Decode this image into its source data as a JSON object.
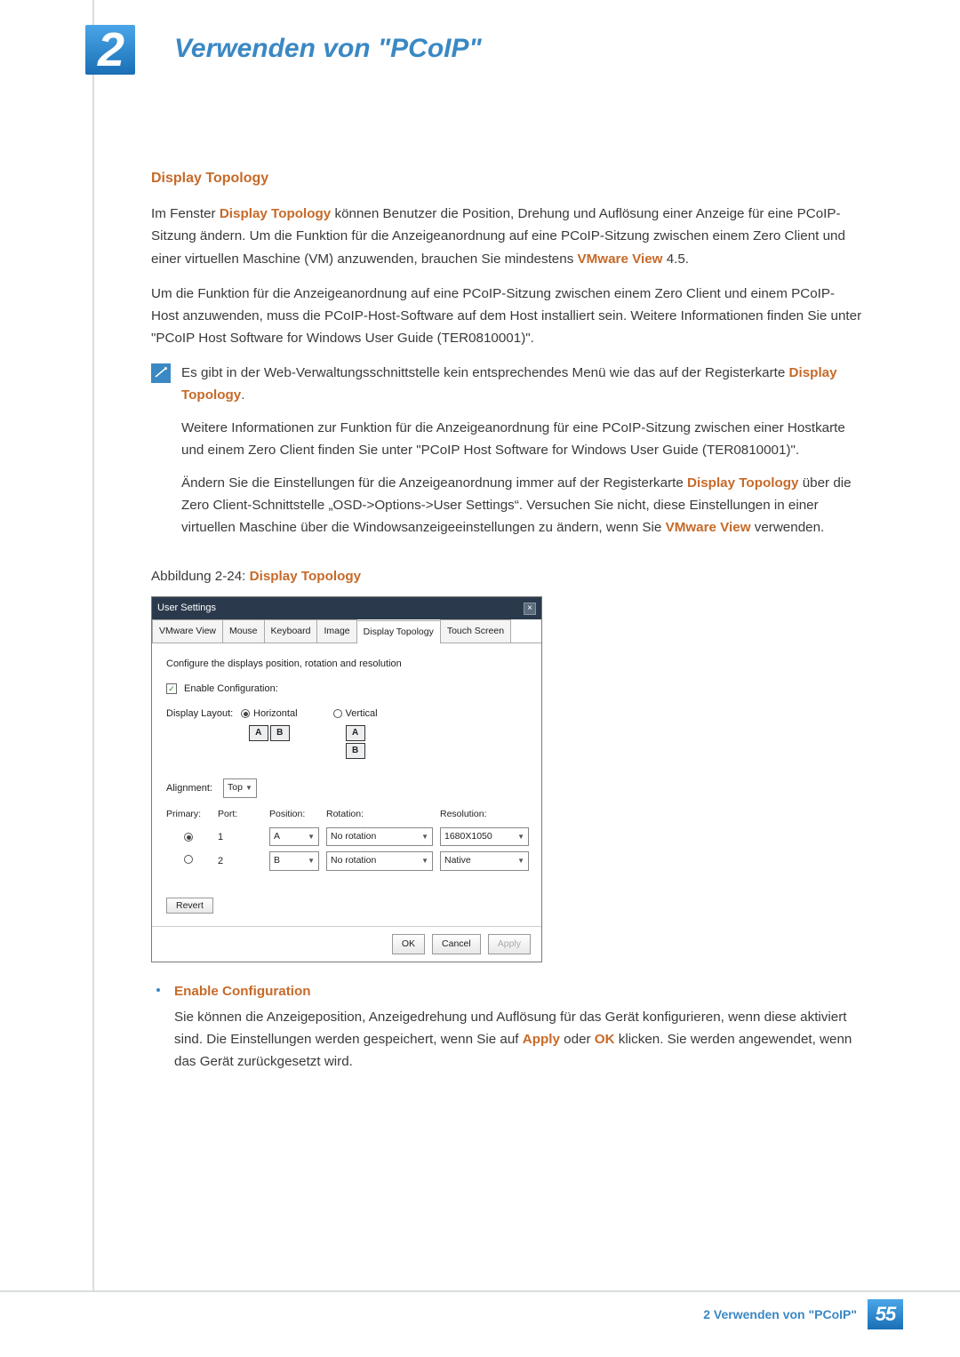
{
  "chapter": {
    "number": "2",
    "title": "Verwenden von \"PCoIP\""
  },
  "section": {
    "heading": "Display Topology"
  },
  "p1": {
    "a": "Im Fenster ",
    "b": "Display Topology",
    "c": " können Benutzer die Position, Drehung und Auflösung einer Anzeige für eine PCoIP-Sitzung ändern. Um die Funktion für die Anzeigeanordnung auf eine PCoIP-Sitzung zwischen einem Zero Client und einer virtuellen Maschine (VM) anzuwenden, brauchen Sie mindestens ",
    "d": "VMware View",
    "e": " 4.5."
  },
  "p2": "Um die Funktion für die Anzeigeanordnung auf eine PCoIP-Sitzung zwischen einem Zero Client und einem PCoIP-Host anzuwenden, muss die PCoIP-Host-Software auf dem Host installiert sein. Weitere Informationen finden Sie unter \"PCoIP Host Software for Windows User Guide (TER0810001)\".",
  "note": {
    "n1a": "Es gibt in der Web-Verwaltungsschnittstelle kein entsprechendes Menü wie das auf der Registerkarte ",
    "n1b": "Display Topology",
    "n1c": ".",
    "n2": "Weitere Informationen zur Funktion für die Anzeigeanordnung für eine PCoIP-Sitzung zwischen einer Hostkarte und einem Zero Client finden Sie unter \"PCoIP Host Software for Windows User Guide (TER0810001)\".",
    "n3a": "Ändern Sie die Einstellungen für die Anzeigeanordnung immer auf der Registerkarte ",
    "n3b": "Display Topology",
    "n3c": " über die Zero Client-Schnittstelle „OSD->Options->User Settings“. Versuchen Sie nicht, diese Einstellungen in einer virtuellen Maschine über die Windowsanzeigeeinstellungen zu ändern, wenn Sie ",
    "n3d": "VMware View",
    "n3e": " verwenden."
  },
  "fig": {
    "prefix": "Abbildung 2-24: ",
    "name": "Display Topology"
  },
  "shot": {
    "title": "User Settings",
    "tabs": [
      "VMware View",
      "Mouse",
      "Keyboard",
      "Image",
      "Display Topology",
      "Touch Screen"
    ],
    "active_tab_index": 4,
    "config_text": "Configure the displays position, rotation and resolution",
    "enable_label": "Enable Configuration:",
    "enable_checked": true,
    "layout_label": "Display Layout:",
    "horizontal": "Horizontal",
    "vertical": "Vertical",
    "layout_selected": "horizontal",
    "alignment_label": "Alignment:",
    "alignment_value": "Top",
    "headers": {
      "primary": "Primary:",
      "port": "Port:",
      "position": "Position:",
      "rotation": "Rotation:",
      "resolution": "Resolution:"
    },
    "rows": [
      {
        "primary_selected": true,
        "port": "1",
        "position": "A",
        "rotation": "No rotation",
        "resolution": "1680X1050"
      },
      {
        "primary_selected": false,
        "port": "2",
        "position": "B",
        "rotation": "No rotation",
        "resolution": "Native"
      }
    ],
    "revert": "Revert",
    "ok": "OK",
    "cancel": "Cancel",
    "apply": "Apply"
  },
  "bullet": {
    "heading": "Enable Configuration",
    "body_a": "Sie können die Anzeigeposition, Anzeigedrehung und Auflösung für das Gerät konfigurieren, wenn diese aktiviert sind. Die Einstellungen werden gespeichert, wenn Sie auf ",
    "body_b": "Apply",
    "body_c": " oder ",
    "body_d": "OK",
    "body_e": " klicken. Sie werden angewendet, wenn das Gerät zurückgesetzt wird."
  },
  "footer": {
    "chapter": "2 Verwenden von \"PCoIP\"",
    "page": "55"
  },
  "letters": {
    "A": "A",
    "B": "B"
  }
}
